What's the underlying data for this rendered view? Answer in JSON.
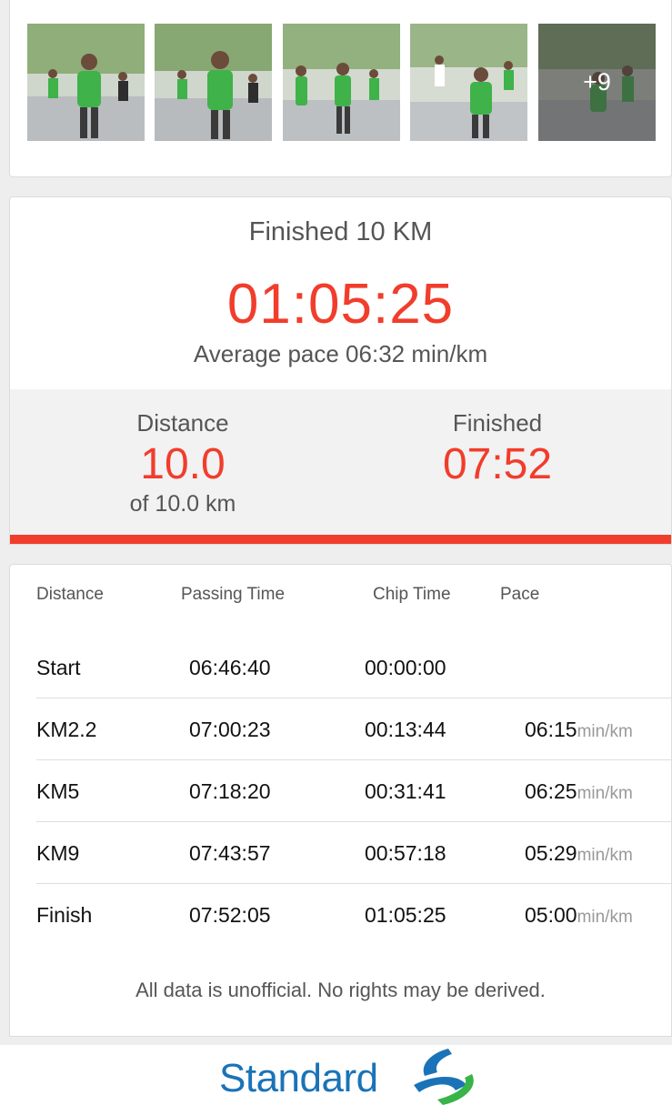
{
  "photos": {
    "more_count": "+9",
    "count_visible": 5
  },
  "result": {
    "title": "Finished 10 KM",
    "time": "01:05:25",
    "avg_pace": "Average pace 06:32 min/km",
    "distance_label": "Distance",
    "distance_value": "10.0",
    "distance_sub": "of 10.0 km",
    "finished_label": "Finished",
    "finished_value": "07:52"
  },
  "splits": {
    "headers": {
      "distance": "Distance",
      "passing": "Passing Time",
      "chip": "Chip Time",
      "pace": "Pace"
    },
    "pace_unit": "min/km",
    "rows": [
      {
        "distance": "Start",
        "passing": "06:46:40",
        "chip": "00:00:00",
        "pace": ""
      },
      {
        "distance": "KM2.2",
        "passing": "07:00:23",
        "chip": "00:13:44",
        "pace": "06:15"
      },
      {
        "distance": "KM5",
        "passing": "07:18:20",
        "chip": "00:31:41",
        "pace": "06:25"
      },
      {
        "distance": "KM9",
        "passing": "07:43:57",
        "chip": "00:57:18",
        "pace": "05:29"
      },
      {
        "distance": "Finish",
        "passing": "07:52:05",
        "chip": "01:05:25",
        "pace": "05:00"
      }
    ],
    "disclaimer": "All data is unofficial. No rights may be derived."
  },
  "footer": {
    "brand": "Standard",
    "colors": {
      "brand_blue": "#1a73b8",
      "brand_green": "#38b449",
      "accent_red": "#f13d2c"
    },
    "logo_icon": "standard-chartered-logo-icon"
  }
}
